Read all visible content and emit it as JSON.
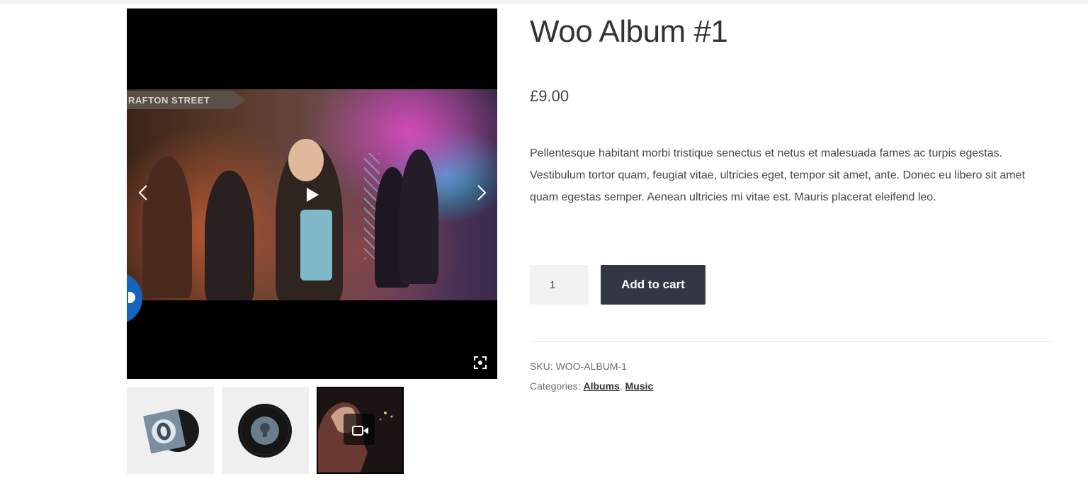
{
  "product": {
    "title": "Woo Album #1",
    "price": "£9.00",
    "description": "Pellentesque habitant morbi tristique senectus et netus et malesuada fames ac turpis egestas. Vestibulum tortor quam, feugiat vitae, ultricies eget, tempor sit amet, ante. Donec eu libero sit amet quam egestas semper. Aenean ultricies mi vitae est. Mauris placerat eleifend leo.",
    "quantity": "1",
    "add_to_cart_label": "Add to cart",
    "sku_label": "SKU:",
    "sku_value": "WOO-ALBUM-1",
    "categories_label": "Categories:",
    "categories": [
      "Albums",
      "Music"
    ],
    "category_separator": ", "
  },
  "gallery": {
    "video_sign_text": "RAFTON STREET",
    "icons": {
      "prev": "chevron-left-icon",
      "next": "chevron-right-icon",
      "play": "play-icon",
      "fullscreen": "fullscreen-icon",
      "video_thumb": "video-camera-icon"
    },
    "thumbnails": [
      "album-cover-thumbnail",
      "vinyl-record-thumbnail",
      "video-thumbnail"
    ],
    "selected_thumbnail": 3
  },
  "colors": {
    "button_bg": "#333645",
    "badge_blue": "#1565c0"
  }
}
